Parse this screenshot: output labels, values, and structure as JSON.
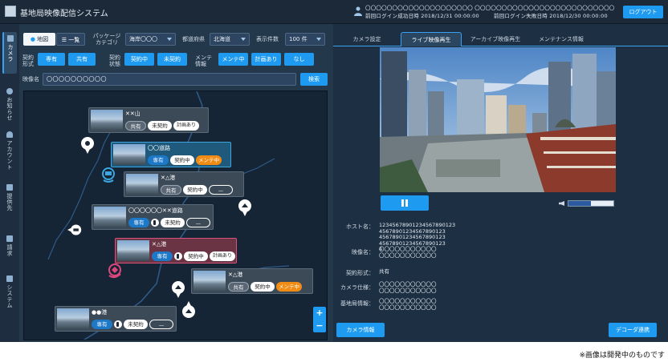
{
  "header": {
    "title": "基地局映像配信システム",
    "user_id": "〇〇〇〇〇〇〇〇〇〇〇〇〇〇〇〇〇〇〇〇 〇〇〇〇〇〇〇〇〇〇〇〇〇〇〇〇〇〇〇〇〇〇〇〇〇〇",
    "last_login_success": "前回ログイン成功日時 2018/12/31 00:00:00",
    "last_login_fail": "前回ログイン失敗日時 2018/12/30 00:00:00",
    "logout_label": "ログアウト"
  },
  "sidebar": {
    "tabs": [
      {
        "label": "カメラ",
        "icon": "camera-icon",
        "active": true
      },
      {
        "label": "お知らせ",
        "icon": "info-icon"
      },
      {
        "label": "アカウント",
        "icon": "user-icon"
      },
      {
        "label": "提供先",
        "icon": "folder-icon"
      },
      {
        "label": "請求",
        "icon": "invoice-icon"
      },
      {
        "label": "システム",
        "icon": "list-icon"
      }
    ]
  },
  "filters": {
    "view_map": "地図",
    "view_list": "一覧",
    "package_label": "パッケージ カテゴリ",
    "package_value": "海岸〇〇〇",
    "pref_label": "都道府県",
    "pref_value": "北海道",
    "count_label": "表示件数",
    "count_value": "100 件",
    "contract_type_label": "契約 形式",
    "ct_exclusive": "専有",
    "ct_shared": "共有",
    "contract_status_label": "契約 状態",
    "cs_contracted": "契約中",
    "cs_uncontracted": "未契約",
    "maint_label": "メンテ 情報",
    "m_in_maint": "メンテ中",
    "m_planned": "計画あり",
    "m_none": "なし",
    "video_name_label": "映像名",
    "video_name_value": "〇〇〇〇〇〇〇〇〇〇",
    "search_label": "検索"
  },
  "map": {
    "cards": [
      {
        "title": "✕✕山",
        "tags": [
          "共有",
          "未契約",
          "計画あり"
        ]
      },
      {
        "title": "〇〇道路",
        "tags": [
          "専有",
          "契約中",
          "メンテ中"
        ]
      },
      {
        "title": "✕△港",
        "tags": [
          "共有",
          "契約中",
          "—"
        ]
      },
      {
        "title": "〇〇〇〇〇〇✕✕道路",
        "tags": [
          "専有",
          "未契約",
          "—"
        ]
      },
      {
        "title": "✕△港",
        "tags": [
          "専有",
          "契約中",
          "計画あり"
        ]
      },
      {
        "title": "✕△港",
        "tags": [
          "共有",
          "契約中",
          "メンテ中"
        ]
      },
      {
        "title": "●●港",
        "tags": [
          "専有",
          "未契約",
          "—"
        ]
      }
    ],
    "zoom_in": "+",
    "zoom_out": "−"
  },
  "right": {
    "tabs": [
      "カメラ設定",
      "ライブ映像再生",
      "アーカイブ映像再生",
      "メンテナンス情報"
    ],
    "active_tab": 1,
    "volume": 0.5,
    "info": [
      {
        "key": "ホスト名：",
        "value": "12345678901234567890123\n45678901234567890123\n45678901234567890123\n45678901234567890123\n4"
      },
      {
        "key": "映像名：",
        "value": "〇〇〇〇〇〇〇〇〇〇〇\n〇〇〇〇〇〇〇〇〇〇〇"
      },
      {
        "key": "契約形式：",
        "value": "共有"
      },
      {
        "key": "カメラ仕様：",
        "value": "〇〇〇〇〇〇〇〇〇〇〇\n〇〇〇〇〇〇〇〇〇〇〇"
      },
      {
        "key": "基地局情報：",
        "value": "〇〇〇〇〇〇〇〇〇〇〇\n〇〇〇〇〇〇〇〇〇〇〇"
      }
    ],
    "camera_info_btn": "カメラ情報",
    "decoder_btn": "デコーダ連携"
  },
  "footnote": "※画像は開発中のものです",
  "colors": {
    "accent": "#1e9bf0",
    "bg": "#24384c",
    "maint": "#f08c14",
    "highlight_blue": "#3aa7e0",
    "highlight_red": "#d6537a"
  }
}
